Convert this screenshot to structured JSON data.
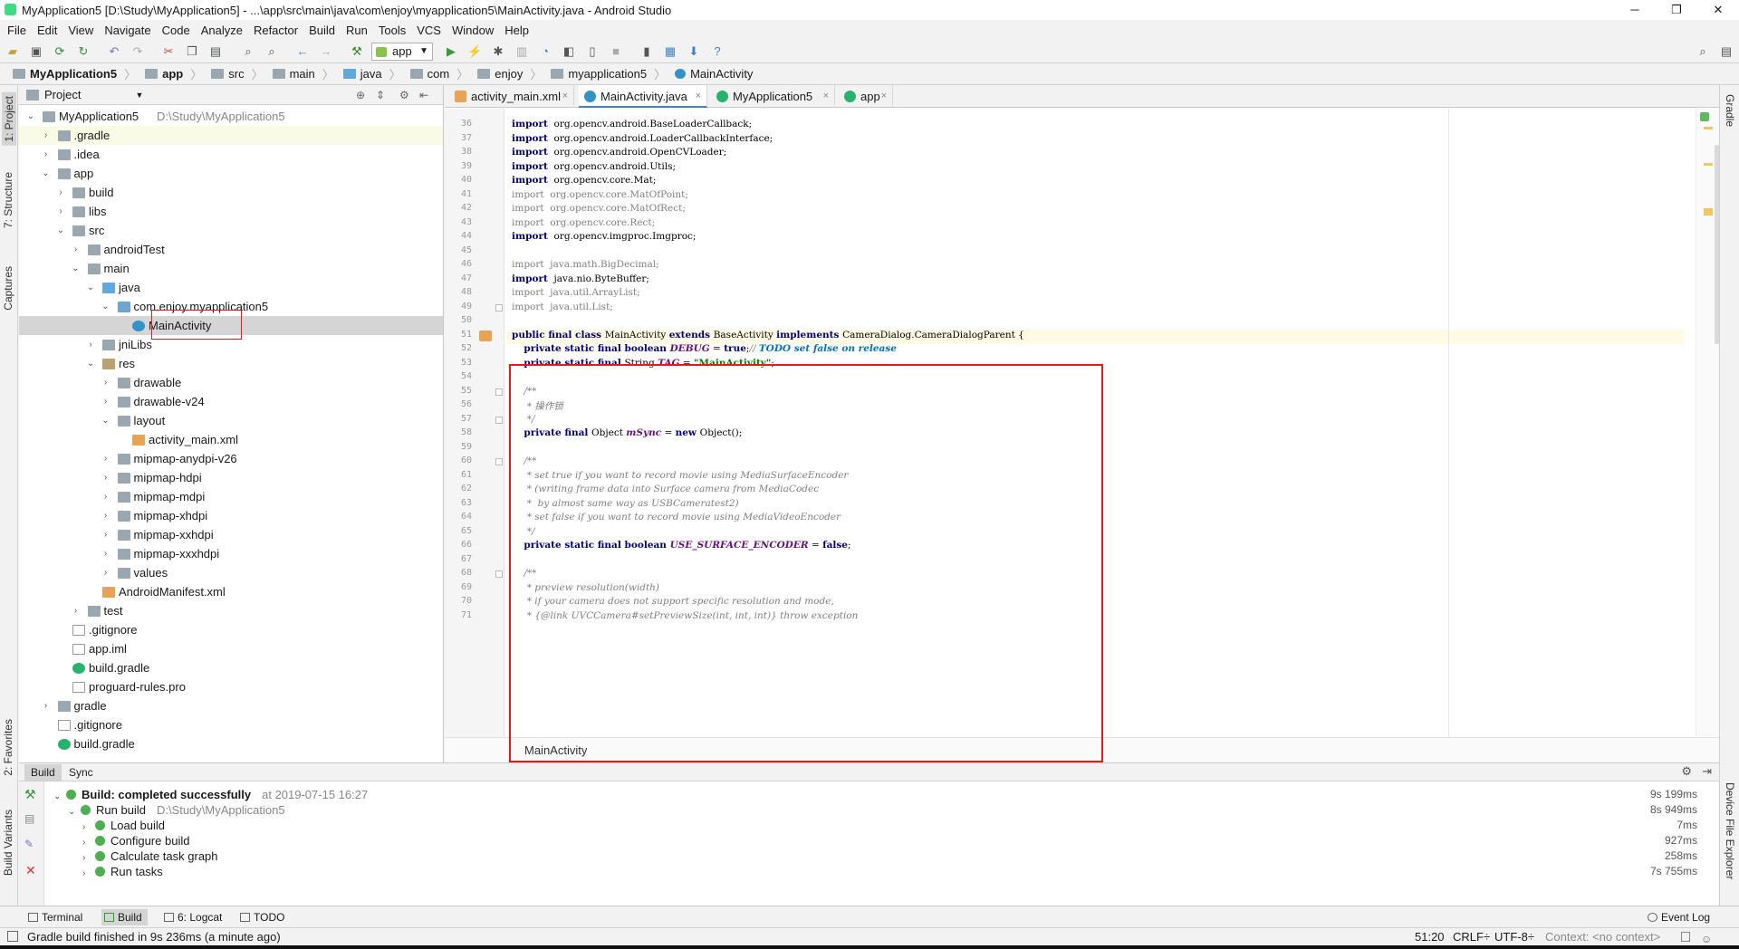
{
  "window": {
    "title": "MyApplication5 [D:\\Study\\MyApplication5] - ...\\app\\src\\main\\java\\com\\enjoy\\myapplication5\\MainActivity.java - Android Studio",
    "minimize": "─",
    "maximize": "❐",
    "close": "✕"
  },
  "menu": [
    "File",
    "Edit",
    "View",
    "Navigate",
    "Code",
    "Analyze",
    "Refactor",
    "Build",
    "Run",
    "Tools",
    "VCS",
    "Window",
    "Help"
  ],
  "toolbar": {
    "run_config": "app"
  },
  "breadcrumbs": [
    "MyApplication5",
    "app",
    "src",
    "main",
    "java",
    "com",
    "enjoy",
    "myapplication5",
    "MainActivity"
  ],
  "left_strip": {
    "project": "1: Project",
    "structure": "7: Structure",
    "captures": "Captures",
    "favorites": "2: Favorites",
    "variants": "Build Variants"
  },
  "right_strip": {
    "gradle": "Gradle",
    "device": "Device File Explorer"
  },
  "project_panel": {
    "header": "Project",
    "rows": [
      {
        "label": "MyApplication5",
        "hint": "D:\\Study\\MyApplication5",
        "level": 0,
        "arrow": "⌄",
        "icon": "f-folder"
      },
      {
        "label": ".gradle",
        "level": 1,
        "arrow": "›",
        "icon": "f-folder"
      },
      {
        "label": ".idea",
        "level": 1,
        "arrow": "›",
        "icon": "f-folder"
      },
      {
        "label": "app",
        "level": 1,
        "arrow": "⌄",
        "icon": "f-folder"
      },
      {
        "label": "build",
        "level": 2,
        "arrow": "›",
        "icon": "f-folder"
      },
      {
        "label": "libs",
        "level": 2,
        "arrow": "›",
        "icon": "f-folder"
      },
      {
        "label": "src",
        "level": 2,
        "arrow": "⌄",
        "icon": "f-folder"
      },
      {
        "label": "androidTest",
        "level": 3,
        "arrow": "›",
        "icon": "f-folder"
      },
      {
        "label": "main",
        "level": 3,
        "arrow": "⌄",
        "icon": "f-folder"
      },
      {
        "label": "java",
        "level": 4,
        "arrow": "⌄",
        "icon": "f-blue"
      },
      {
        "label": "com.enjoy.myapplication5",
        "level": 5,
        "arrow": "⌄",
        "icon": "f-src"
      },
      {
        "label": "MainActivity",
        "level": 6,
        "arrow": "",
        "icon": "f-class"
      },
      {
        "label": "jniLibs",
        "level": 4,
        "arrow": "›",
        "icon": "f-folder"
      },
      {
        "label": "res",
        "level": 4,
        "arrow": "⌄",
        "icon": "f-res"
      },
      {
        "label": "drawable",
        "level": 5,
        "arrow": "›",
        "icon": "f-folder"
      },
      {
        "label": "drawable-v24",
        "level": 5,
        "arrow": "›",
        "icon": "f-folder"
      },
      {
        "label": "layout",
        "level": 5,
        "arrow": "⌄",
        "icon": "f-folder"
      },
      {
        "label": "activity_main.xml",
        "level": 6,
        "arrow": "",
        "icon": "f-xml"
      },
      {
        "label": "mipmap-anydpi-v26",
        "level": 5,
        "arrow": "›",
        "icon": "f-folder"
      },
      {
        "label": "mipmap-hdpi",
        "level": 5,
        "arrow": "›",
        "icon": "f-folder"
      },
      {
        "label": "mipmap-mdpi",
        "level": 5,
        "arrow": "›",
        "icon": "f-folder"
      },
      {
        "label": "mipmap-xhdpi",
        "level": 5,
        "arrow": "›",
        "icon": "f-folder"
      },
      {
        "label": "mipmap-xxhdpi",
        "level": 5,
        "arrow": "›",
        "icon": "f-folder"
      },
      {
        "label": "mipmap-xxxhdpi",
        "level": 5,
        "arrow": "›",
        "icon": "f-folder"
      },
      {
        "label": "values",
        "level": 5,
        "arrow": "›",
        "icon": "f-folder"
      },
      {
        "label": "AndroidManifest.xml",
        "level": 4,
        "arrow": "",
        "icon": "f-xml"
      },
      {
        "label": "test",
        "level": 3,
        "arrow": "›",
        "icon": "f-folder"
      },
      {
        "label": ".gitignore",
        "level": 2,
        "arrow": "",
        "icon": "f-file"
      },
      {
        "label": "app.iml",
        "level": 2,
        "arrow": "",
        "icon": "f-file"
      },
      {
        "label": "build.gradle",
        "level": 2,
        "arrow": "",
        "icon": "f-gradle"
      },
      {
        "label": "proguard-rules.pro",
        "level": 2,
        "arrow": "",
        "icon": "f-file"
      },
      {
        "label": "gradle",
        "level": 1,
        "arrow": "›",
        "icon": "f-folder"
      },
      {
        "label": ".gitignore",
        "level": 1,
        "arrow": "",
        "icon": "f-file"
      },
      {
        "label": "build.gradle",
        "level": 1,
        "arrow": "",
        "icon": "f-gradle"
      }
    ]
  },
  "editor": {
    "tabs": [
      {
        "label": "activity_main.xml",
        "color": "#e8a355"
      },
      {
        "label": "MainActivity.java",
        "color": "#3592c4"
      },
      {
        "label": "MyApplication5",
        "color": "#27b36d"
      },
      {
        "label": "app",
        "color": "#27b36d"
      }
    ],
    "close_glyph": "×",
    "line_numbers": [
      "36",
      "37",
      "38",
      "39",
      "40",
      "41",
      "42",
      "43",
      "44",
      "45",
      "46",
      "47",
      "48",
      "49",
      "50",
      "51",
      "52",
      "53",
      "54",
      "55",
      "56",
      "57",
      "58",
      "59",
      "60",
      "61",
      "62",
      "63",
      "64",
      "65",
      "66",
      "67",
      "68",
      "69",
      "70",
      "71"
    ],
    "lines": [
      [
        [
          "kw",
          "import"
        ],
        [
          "",
          "  org.opencv.android.BaseLoaderCallback;"
        ]
      ],
      [
        [
          "kw",
          "import"
        ],
        [
          "",
          "  org.opencv.android.LoaderCallbackInterface;"
        ]
      ],
      [
        [
          "kw",
          "import"
        ],
        [
          "",
          "  org.opencv.android.OpenCVLoader;"
        ]
      ],
      [
        [
          "kw",
          "import"
        ],
        [
          "",
          "  org.opencv.android.Utils;"
        ]
      ],
      [
        [
          "kw",
          "import"
        ],
        [
          "",
          "  org.opencv.core.Mat;"
        ]
      ],
      [
        [
          "imp",
          "import  org.opencv.core.MatOfPoint;"
        ]
      ],
      [
        [
          "imp",
          "import  org.opencv.core.MatOfRect;"
        ]
      ],
      [
        [
          "imp",
          "import  org.opencv.core.Rect;"
        ]
      ],
      [
        [
          "kw",
          "import"
        ],
        [
          "",
          "  org.opencv.imgproc.Imgproc;"
        ]
      ],
      [],
      [
        [
          "imp",
          "import  java.math.BigDecimal;"
        ]
      ],
      [
        [
          "kw",
          "import"
        ],
        [
          "",
          "  java.nio.ByteBuffer;"
        ]
      ],
      [
        [
          "imp",
          "import  java.util.ArrayList;"
        ]
      ],
      [
        [
          "imp",
          "import  java.util.List;"
        ]
      ],
      [],
      [
        [
          "kw",
          "public final class "
        ],
        [
          "",
          "MainActivity "
        ],
        [
          "kw",
          "extends "
        ],
        [
          "",
          "BaseActivity "
        ],
        [
          "kw",
          "implements "
        ],
        [
          "",
          "CameraDialog.CameraDialogParent {"
        ]
      ],
      [
        [
          "",
          "    "
        ],
        [
          "kw",
          "private static final boolean "
        ],
        [
          "fld",
          "DEBUG"
        ],
        [
          "",
          " = "
        ],
        [
          "kw",
          "true"
        ],
        [
          "",
          ";"
        ],
        [
          "cm",
          "// "
        ],
        [
          "cmb",
          "TODO set false on release"
        ]
      ],
      [
        [
          "",
          "    "
        ],
        [
          "kw",
          "private static final "
        ],
        [
          "",
          "String "
        ],
        [
          "fld",
          "TAG"
        ],
        [
          "",
          " = "
        ],
        [
          "str",
          "\"MainActivity\""
        ],
        [
          "",
          ";"
        ]
      ],
      [],
      [
        [
          "cm",
          "    /**"
        ]
      ],
      [
        [
          "cm",
          "     * 操作锁"
        ]
      ],
      [
        [
          "cm",
          "     */"
        ]
      ],
      [
        [
          "",
          "    "
        ],
        [
          "kw",
          "private final "
        ],
        [
          "",
          "Object "
        ],
        [
          "fld",
          "mSync"
        ],
        [
          "",
          " = "
        ],
        [
          "kw",
          "new "
        ],
        [
          "",
          "Object();"
        ]
      ],
      [],
      [
        [
          "cm",
          "    /**"
        ]
      ],
      [
        [
          "cm",
          "     * set true if you want to record movie using MediaSurfaceEncoder"
        ]
      ],
      [
        [
          "cm",
          "     * (writing frame data into Surface camera from MediaCodec"
        ]
      ],
      [
        [
          "cm",
          "     *  by almost same way as USBCameratest2)"
        ]
      ],
      [
        [
          "cm",
          "     * set false if you want to record movie using MediaVideoEncoder"
        ]
      ],
      [
        [
          "cm",
          "     */"
        ]
      ],
      [
        [
          "",
          "    "
        ],
        [
          "kw",
          "private static final boolean "
        ],
        [
          "fld",
          "USE_SURFACE_ENCODER"
        ],
        [
          "",
          " = "
        ],
        [
          "kw",
          "false"
        ],
        [
          "",
          ";"
        ]
      ],
      [],
      [
        [
          "cm",
          "    /**"
        ]
      ],
      [
        [
          "cm",
          "     * preview resolution(width)"
        ]
      ],
      [
        [
          "cm",
          "     * if your camera does not support specific resolution and mode,"
        ]
      ],
      [
        [
          "cm",
          "     * {@link UVCCamera#setPreviewSize(int, int, int)} throw exception"
        ]
      ]
    ],
    "footer": "MainActivity"
  },
  "build_panel": {
    "tabs": [
      "Build",
      "Sync"
    ],
    "rows": [
      {
        "label": "Build: completed successfully",
        "extra": "at 2019-07-15 16:27",
        "time": "9s 199ms",
        "level": 0
      },
      {
        "label": "Run build",
        "extra": "D:\\Study\\MyApplication5",
        "time": "8s 949ms",
        "level": 1
      },
      {
        "label": "Load build",
        "extra": "",
        "time": "7ms",
        "level": 2
      },
      {
        "label": "Configure build",
        "extra": "",
        "time": "927ms",
        "level": 2
      },
      {
        "label": "Calculate task graph",
        "extra": "",
        "time": "258ms",
        "level": 2
      },
      {
        "label": "Run tasks",
        "extra": "",
        "time": "7s 755ms",
        "level": 2
      }
    ]
  },
  "bottom_tabs": [
    "Terminal",
    "Build",
    "6: Logcat",
    "TODO"
  ],
  "event_log": "Event Log",
  "status": {
    "message": "Gradle build finished in 9s 236ms (a minute ago)",
    "position": "51:20",
    "line_sep": "CRLF÷",
    "encoding": "UTF-8÷",
    "context": "Context: <no context>"
  }
}
